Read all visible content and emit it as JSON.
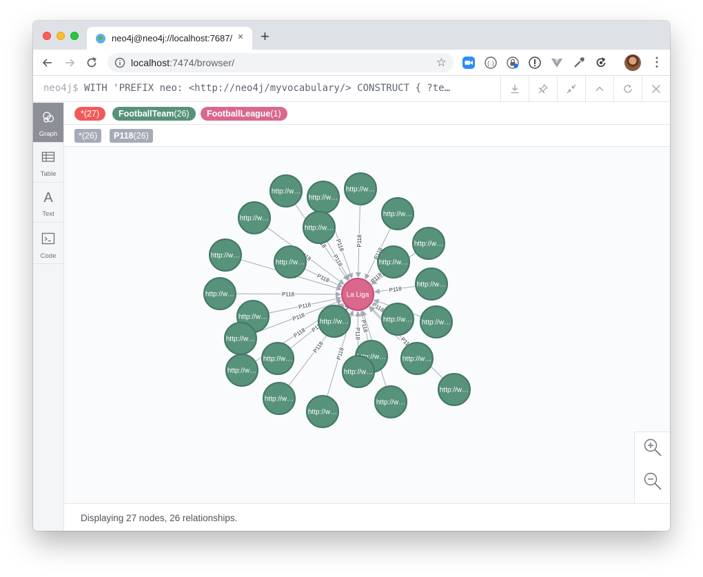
{
  "browser": {
    "tab_title": "neo4j@neo4j://localhost:7687/",
    "tab_close": "×",
    "new_tab": "+",
    "url_host": "localhost",
    "url_path": ":7474/browser/"
  },
  "command": {
    "prompt": "neo4j$",
    "query": " WITH 'PREFIX neo: <http://neo4j/myvocabulary/> CONSTRUCT { ?te…"
  },
  "sidebar": {
    "items": [
      {
        "label": "Graph",
        "icon": "graph-icon",
        "active": true
      },
      {
        "label": "Table",
        "icon": "table-icon",
        "active": false
      },
      {
        "label": "Text",
        "icon": "text-icon",
        "active": false
      },
      {
        "label": "Code",
        "icon": "code-icon",
        "active": false
      }
    ]
  },
  "labels": [
    {
      "name": "*",
      "count": "(27)",
      "color": "#f25a5a"
    },
    {
      "name": "FootballTeam",
      "count": "(26)",
      "color": "#57927a"
    },
    {
      "name": "FootballLeague",
      "count": "(1)",
      "color": "#d9688c"
    }
  ],
  "relationships": [
    {
      "name": "*",
      "count": "(26)"
    },
    {
      "name": "P118",
      "count": "(26)"
    }
  ],
  "graph": {
    "center_label": "La Liga",
    "center_color": "#d9688c",
    "team_color": "#57927a",
    "team_label": "http://w…",
    "rel_label": "P118",
    "team_count": 26
  },
  "status": {
    "text": "Displaying 27 nodes, 26 relationships."
  }
}
